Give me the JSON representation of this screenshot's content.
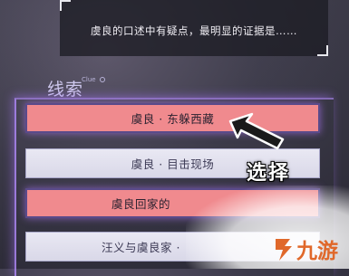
{
  "dialog": {
    "text": "虞良的口述中有疑点，最明显的证据是……"
  },
  "clue": {
    "title": "线索",
    "subtitle": "Clue"
  },
  "options": [
    {
      "label": "虞良 · 东躲西藏",
      "state": "selected"
    },
    {
      "label": "虞良 · 目击现场",
      "state": "normal"
    },
    {
      "label": "虞良回家的",
      "state": "selected"
    },
    {
      "label": "汪义与虞良家 ·",
      "state": "normal"
    }
  ],
  "annotation": {
    "label": "选择",
    "arrow_icon": "arrow-pointer-icon"
  },
  "watermark": {
    "text": "九游",
    "logo_icon": "9you-logo-icon"
  },
  "colors": {
    "selected_option": "#f08a8e",
    "normal_option": "#e9e8f3",
    "glow": "#b48cff",
    "watermark": "#e0682a"
  }
}
